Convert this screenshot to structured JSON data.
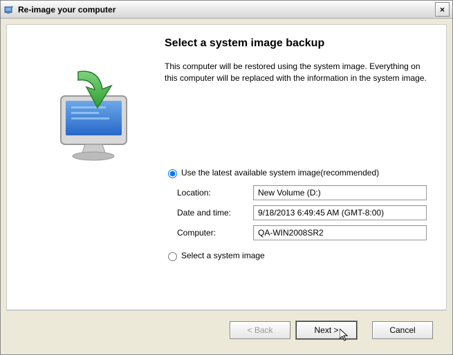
{
  "window": {
    "title": "Re-image your computer",
    "close": "×"
  },
  "heading": "Select a system image backup",
  "description": "This computer will be restored using the system image. Everything on this computer will be replaced with the information in the system image.",
  "options": {
    "use_latest": "Use the latest available system image(recommended)",
    "select_image": "Select a system image"
  },
  "fields": {
    "location_label": "Location:",
    "location_value": "New Volume (D:)",
    "datetime_label": "Date and time:",
    "datetime_value": "9/18/2013 6:49:45 AM (GMT-8:00)",
    "computer_label": "Computer:",
    "computer_value": "QA-WIN2008SR2"
  },
  "buttons": {
    "back": "< Back",
    "next": "Next >",
    "cancel": "Cancel"
  }
}
